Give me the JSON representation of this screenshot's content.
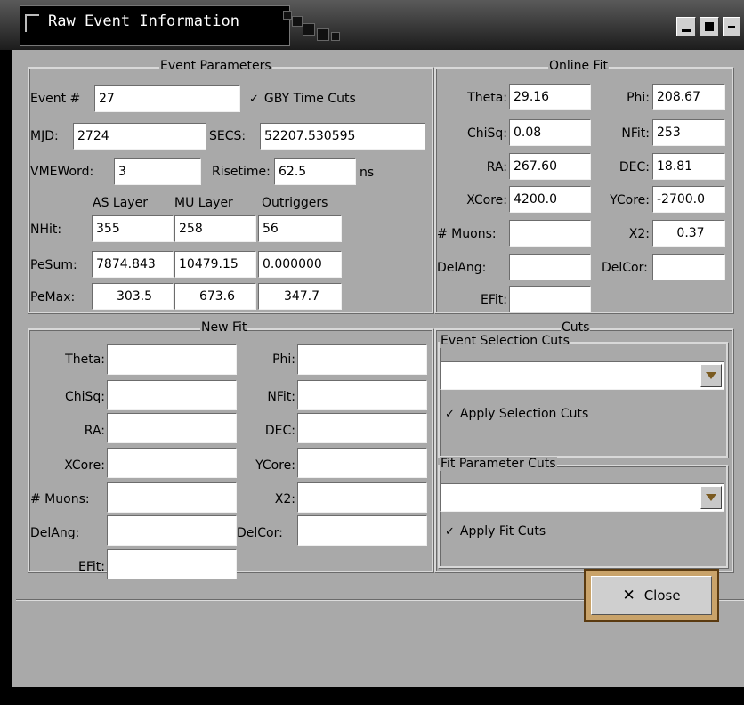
{
  "window": {
    "title": "Raw Event Information",
    "controls": [
      "minimize-icon",
      "maximize-icon",
      "close-icon"
    ]
  },
  "event_parameters": {
    "legend": "Event Parameters",
    "event_label": "Event #",
    "event_value": "27",
    "gby_label": "GBY Time Cuts",
    "gby_checked": true,
    "mjd_label": "MJD:",
    "mjd_value": "2724",
    "secs_label": "SECS:",
    "secs_value": "52207.530595",
    "vmeword_label": "VMEWord:",
    "vmeword_value": "3",
    "risetime_label": "Risetime:",
    "risetime_value": "62.5",
    "risetime_unit": "ns",
    "columns": [
      "AS Layer",
      "MU Layer",
      "Outriggers"
    ],
    "rows": [
      {
        "label": "NHit:",
        "values": [
          "355",
          "258",
          "56"
        ]
      },
      {
        "label": "PeSum:",
        "values": [
          "7874.843",
          "10479.15",
          "0.000000"
        ]
      },
      {
        "label": "PeMax:",
        "values": [
          "303.5",
          "673.6",
          "347.7"
        ]
      }
    ]
  },
  "online_fit": {
    "legend": "Online Fit",
    "left": [
      {
        "label": "Theta:",
        "value": "29.16"
      },
      {
        "label": "ChiSq:",
        "value": "0.08"
      },
      {
        "label": "RA:",
        "value": "267.60"
      },
      {
        "label": "XCore:",
        "value": "4200.0"
      },
      {
        "label": "# Muons:",
        "value": ""
      },
      {
        "label": "DelAng:",
        "value": ""
      },
      {
        "label": "EFit:",
        "value": ""
      }
    ],
    "right": [
      {
        "label": "Phi:",
        "value": "208.67"
      },
      {
        "label": "NFit:",
        "value": "253"
      },
      {
        "label": "DEC:",
        "value": "18.81"
      },
      {
        "label": "YCore:",
        "value": "-2700.0"
      },
      {
        "label": "X2:",
        "value": "0.37"
      },
      {
        "label": "DelCor:",
        "value": ""
      }
    ]
  },
  "new_fit": {
    "legend": "New Fit",
    "left": [
      {
        "label": "Theta:",
        "value": ""
      },
      {
        "label": "ChiSq:",
        "value": ""
      },
      {
        "label": "RA:",
        "value": ""
      },
      {
        "label": "XCore:",
        "value": ""
      },
      {
        "label": "# Muons:",
        "value": ""
      },
      {
        "label": "DelAng:",
        "value": ""
      },
      {
        "label": "EFit:",
        "value": ""
      }
    ],
    "right": [
      {
        "label": "Phi:",
        "value": ""
      },
      {
        "label": "NFit:",
        "value": ""
      },
      {
        "label": "DEC:",
        "value": ""
      },
      {
        "label": "YCore:",
        "value": ""
      },
      {
        "label": "X2:",
        "value": ""
      },
      {
        "label": "DelCor:",
        "value": ""
      }
    ]
  },
  "cuts": {
    "legend": "Cuts",
    "event_selection": {
      "legend": "Event Selection Cuts",
      "selected": "",
      "apply_label": "Apply Selection Cuts",
      "apply_checked": true
    },
    "fit_parameter": {
      "legend": "Fit Parameter Cuts",
      "selected": "",
      "apply_label": "Apply Fit Cuts",
      "apply_checked": true
    }
  },
  "buttons": {
    "close_label": "Close",
    "close_icon": "x-icon"
  },
  "colors": {
    "window_bg": "#a9a9a9",
    "close_highlight": "#c9a36a"
  }
}
